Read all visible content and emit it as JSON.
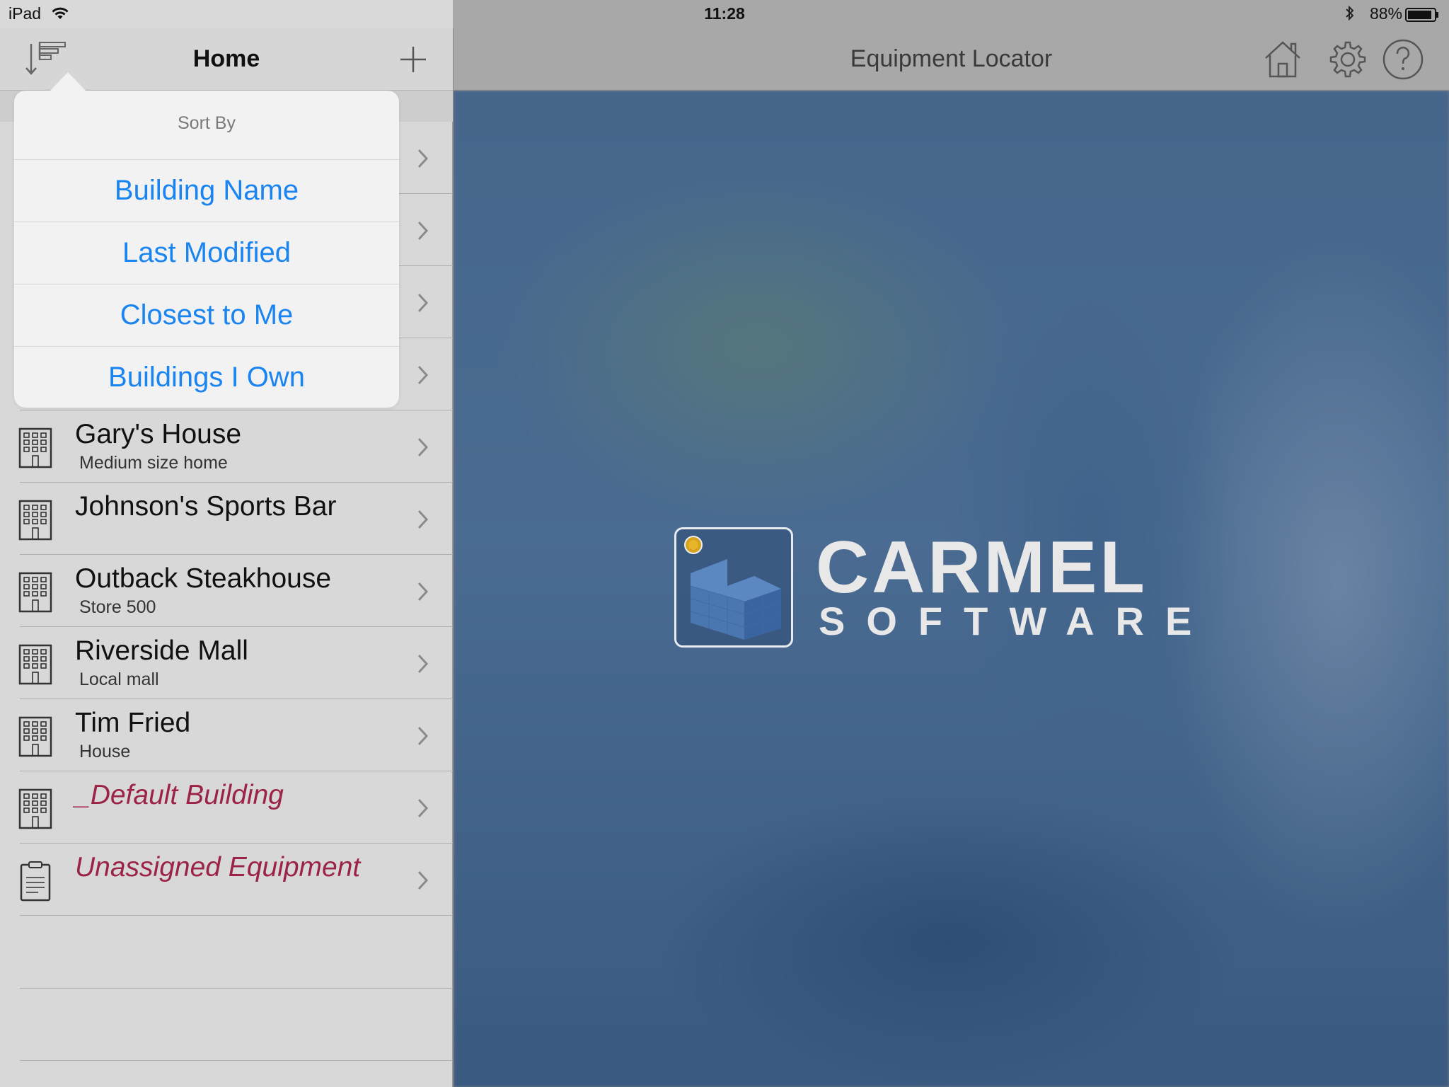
{
  "status_bar": {
    "device": "iPad",
    "time": "11:28",
    "battery": "88%"
  },
  "left_nav": {
    "title": "Home",
    "sort_icon": "sort-icon",
    "add_icon": "plus-icon"
  },
  "popover": {
    "title": "Sort By",
    "options": [
      "Building Name",
      "Last Modified",
      "Closest to Me",
      "Buildings I Own"
    ]
  },
  "buildings": [
    {
      "title": "Gary's House",
      "subtitle": "Medium size home",
      "icon": "building-icon"
    },
    {
      "title": "Johnson's Sports Bar",
      "subtitle": "",
      "icon": "building-icon"
    },
    {
      "title": "Outback Steakhouse",
      "subtitle": "Store 500",
      "icon": "building-icon"
    },
    {
      "title": "Riverside Mall",
      "subtitle": "Local mall",
      "icon": "building-icon"
    },
    {
      "title": "Tim Fried",
      "subtitle": "House",
      "icon": "building-icon"
    },
    {
      "title": "_Default Building",
      "subtitle": "",
      "icon": "building-icon"
    },
    {
      "title": "Unassigned Equipment",
      "subtitle": "",
      "icon": "clipboard-icon"
    }
  ],
  "right_nav": {
    "title": "Equipment Locator",
    "icons": [
      "home-icon",
      "gear-icon",
      "help-icon"
    ]
  },
  "logo": {
    "main": "CARMEL",
    "sub": "SOFTWARE"
  },
  "colors": {
    "accent": "#1a84f0",
    "special_item": "#9b2346"
  }
}
